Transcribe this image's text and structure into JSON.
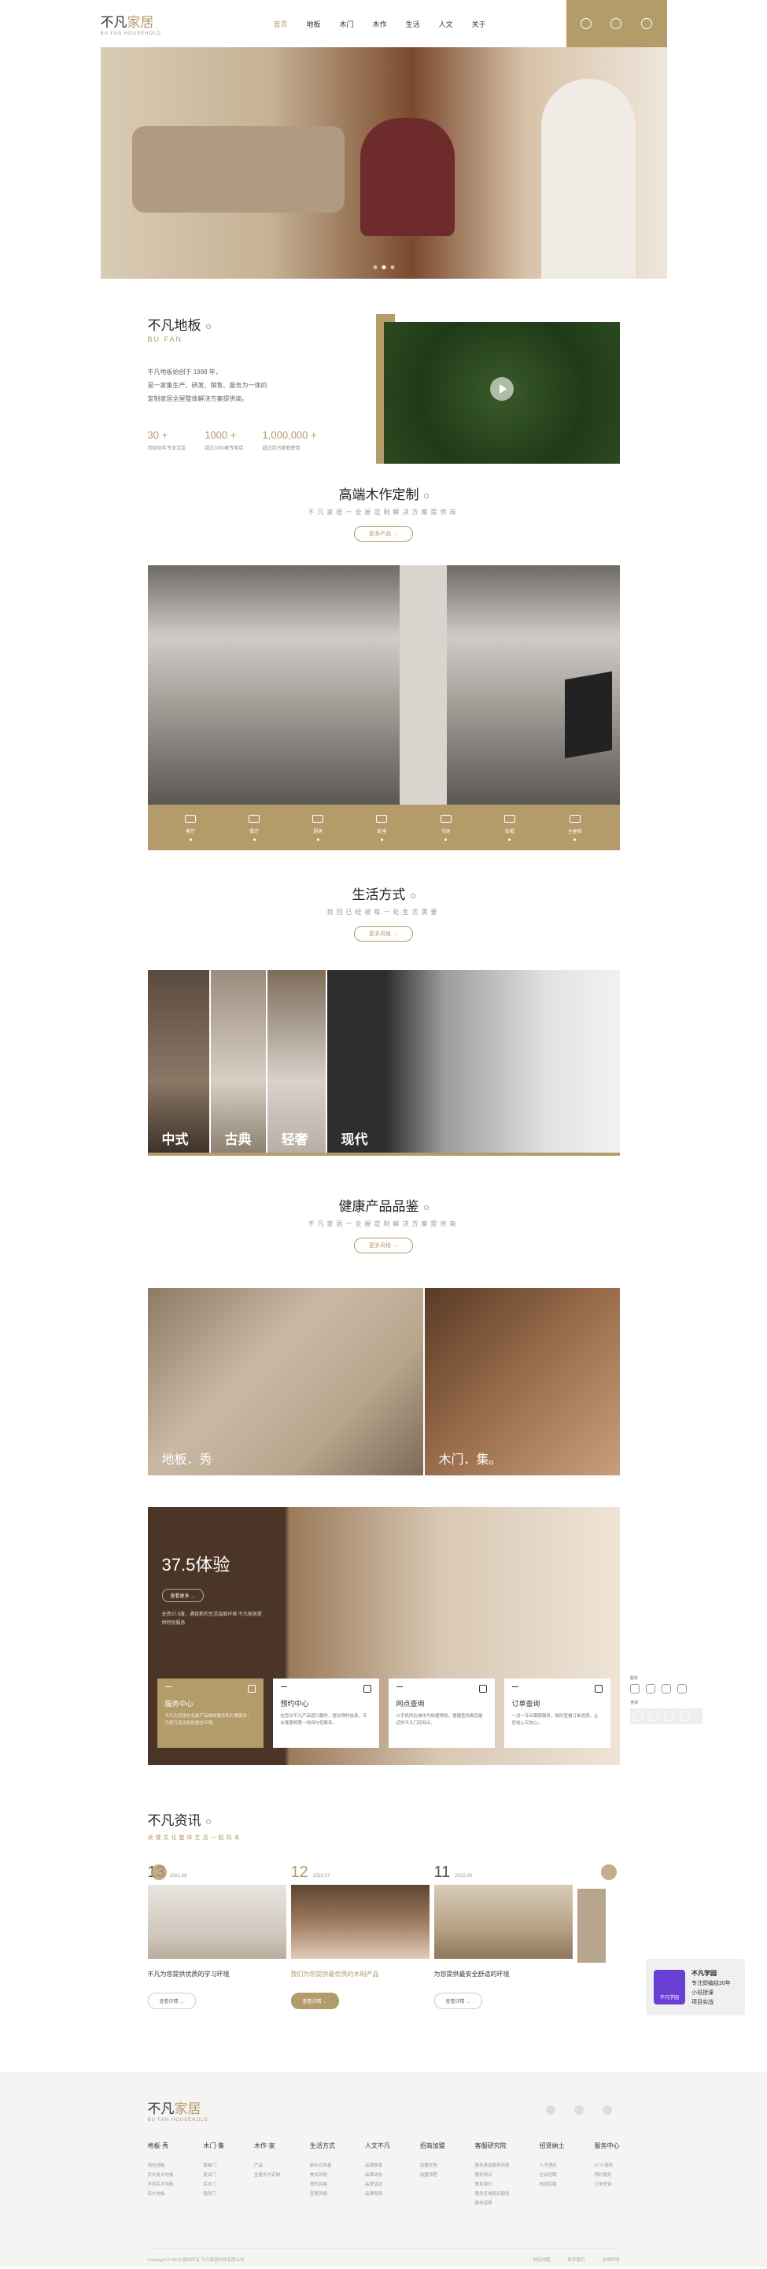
{
  "header": {
    "logo_cn_a": "不凡",
    "logo_cn_b": "家居",
    "logo_en": "BU FAN  HOUSEHOLD",
    "nav": [
      "首页",
      "地板",
      "木门",
      "木作",
      "生活",
      "人文",
      "关于"
    ]
  },
  "about": {
    "title": "不凡地板",
    "subtitle": "BU FAN",
    "desc": [
      "不凡地板始创于 1998 年，",
      "是一家集生产、研发、销售、服务为一体的",
      "定制家居全屋整体解决方案提供商。"
    ],
    "stats": [
      {
        "num": "30 +",
        "label": "历经30年专业沉淀"
      },
      {
        "num": "1000 +",
        "label": "超过1000家专卖店"
      },
      {
        "num": "1,000,000 +",
        "label": "超过百万家庭使用"
      }
    ]
  },
  "woodwork": {
    "title": "高端木作定制",
    "subtitle": "不凡家居一全屋定制解决方案提供商",
    "more": "更多产品",
    "categories": [
      "客厅",
      "餐厅",
      "厨房",
      "卧室",
      "书房",
      "衣帽",
      "全屋柜"
    ]
  },
  "lifestyle": {
    "title": "生活方式",
    "subtitle": "找回已经被每一处生活需要",
    "more": "更多风格",
    "styles": [
      "中式",
      "古典",
      "轻奢",
      "现代"
    ]
  },
  "health": {
    "title": "健康产品品鉴",
    "subtitle": "不凡家居一全屋定制解决方案提供商",
    "more": "更多风格",
    "panels": [
      "地板．秀",
      "木门．集。"
    ]
  },
  "experience": {
    "title": "37.5体验",
    "more": "查看更多",
    "desc": "无畏37.5度，遇接新的生活温度环境 不凡家居提供特别服务",
    "cards": [
      {
        "title": "服务中心",
        "desc": "不凡为您提供全面产品维修服务和方案服务，为您打造全新的居住环境。"
      },
      {
        "title": "预约中心",
        "desc": "在您对不凡产品感兴趣时，提交预约信息，专业客服将第一时间与您联系。"
      },
      {
        "title": "网点查询",
        "desc": "以手机所在城市为依据导航，便捷查找离您最近的不凡门店网点。"
      },
      {
        "title": "订单查询",
        "desc": "一对一专业跟踪服务，随时查看订单进度，让您省心又放心。"
      }
    ]
  },
  "side_widget": {
    "label_a": "服务",
    "label_b": "咨询"
  },
  "news": {
    "title": "不凡资讯",
    "subtitle": "读懂文化整体生活一起向未",
    "items": [
      {
        "day": "13",
        "month": "2022.08",
        "title": "不凡为您提供优质的学习环境",
        "btn": "查看详情"
      },
      {
        "day": "12",
        "month": "2022.07",
        "title": "我们为您提供最优质的木制产品",
        "btn": "查看详情"
      },
      {
        "day": "11",
        "month": "2022.06",
        "title": "为您提供最安全舒适的环境",
        "btn": "查看详情"
      }
    ]
  },
  "promo": {
    "icon_label": "不凡学园",
    "line1": "不凡学园",
    "line2": "专注即编绘20年",
    "line3": "小班授课",
    "line4": "项目实战"
  },
  "footer": {
    "columns": [
      {
        "h": "地板·秀",
        "links": [
          "强化地板",
          "实木复合地板",
          "多层实木地板",
          "实木地板"
        ]
      },
      {
        "h": "木门·集",
        "links": [
          "套装门",
          "复合门",
          "实木门",
          "隐形门"
        ]
      },
      {
        "h": "木作·家",
        "links": [
          "产品",
          "全屋木作定制"
        ]
      },
      {
        "h": "生活方式",
        "links": [
          "新中式风格",
          "美式风格",
          "现代风格",
          "轻奢风格"
        ]
      },
      {
        "h": "人文不凡",
        "links": [
          "品牌故事",
          "品牌动态",
          "品牌活动",
          "品牌视频"
        ]
      },
      {
        "h": "招商加盟",
        "links": [
          "加盟优势",
          "加盟流程"
        ]
      },
      {
        "h": "客服研究院",
        "links": [
          "服务承诺服务流程",
          "服务网点",
          "联系我们",
          "服务区域售后服务",
          "服务保障"
        ]
      },
      {
        "h": "招贤纳士",
        "links": [
          "人才理念",
          "社会招聘",
          "校园招聘"
        ]
      },
      {
        "h": "服务中心",
        "links": [
          "37.5°服务",
          "预约服务",
          "订单查询"
        ]
      }
    ],
    "copyright": "Copyright © 2019 版权所有 不凡家居科技有限公司",
    "links": [
      "网站地图",
      "联系我们",
      "法律声明"
    ]
  },
  "colors": {
    "accent": "#b39b6a",
    "dark_brown": "#4a3526"
  }
}
